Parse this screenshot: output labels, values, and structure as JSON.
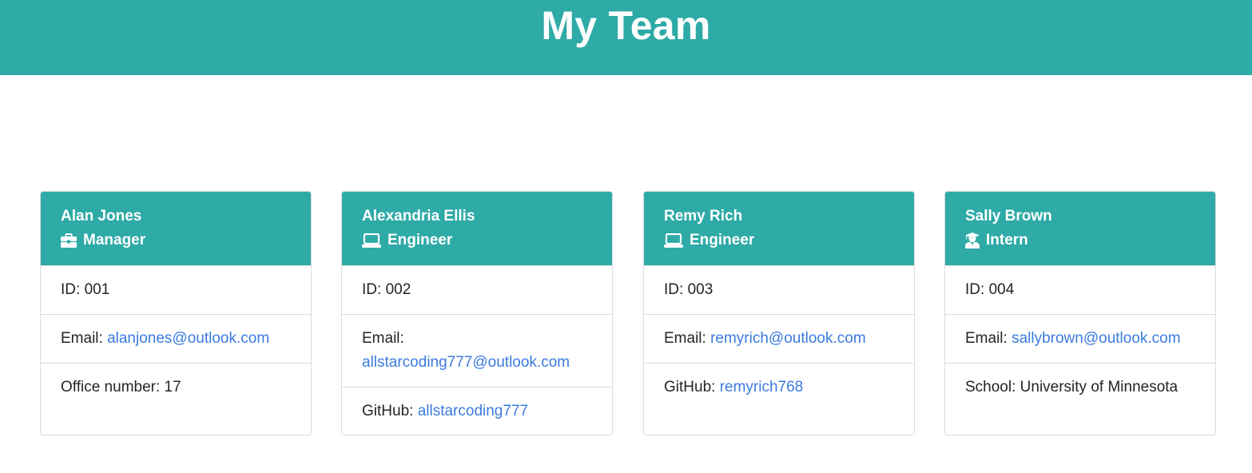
{
  "page": {
    "title": "My Team"
  },
  "colors": {
    "header_bg": "#2eaaa7",
    "link": "#3b7bdf"
  },
  "team": [
    {
      "name": "Alan Jones",
      "role": "Manager",
      "role_icon": "briefcase-icon",
      "id_label": "ID: ",
      "id": "001",
      "email_label": "Email: ",
      "email": "alanjones@outlook.com",
      "extra_label": "Office number: ",
      "extra_value": "17"
    },
    {
      "name": "Alexandria Ellis",
      "role": "Engineer",
      "role_icon": "laptop-icon",
      "id_label": "ID: ",
      "id": "002",
      "email_label": "Email: ",
      "email": "allstarcoding777@outlook.com",
      "extra_label": "GitHub: ",
      "extra_value": "allstarcoding777"
    },
    {
      "name": "Remy Rich",
      "role": "Engineer",
      "role_icon": "laptop-icon",
      "id_label": "ID: ",
      "id": "003",
      "email_label": "Email: ",
      "email": "remyrich@outlook.com",
      "extra_label": "GitHub: ",
      "extra_value": "remyrich768"
    },
    {
      "name": "Sally Brown",
      "role": "Intern",
      "role_icon": "graduate-icon",
      "id_label": "ID: ",
      "id": "004",
      "email_label": "Email: ",
      "email": "sallybrown@outlook.com",
      "extra_label": "School: ",
      "extra_value": "University of Minnesota"
    }
  ]
}
